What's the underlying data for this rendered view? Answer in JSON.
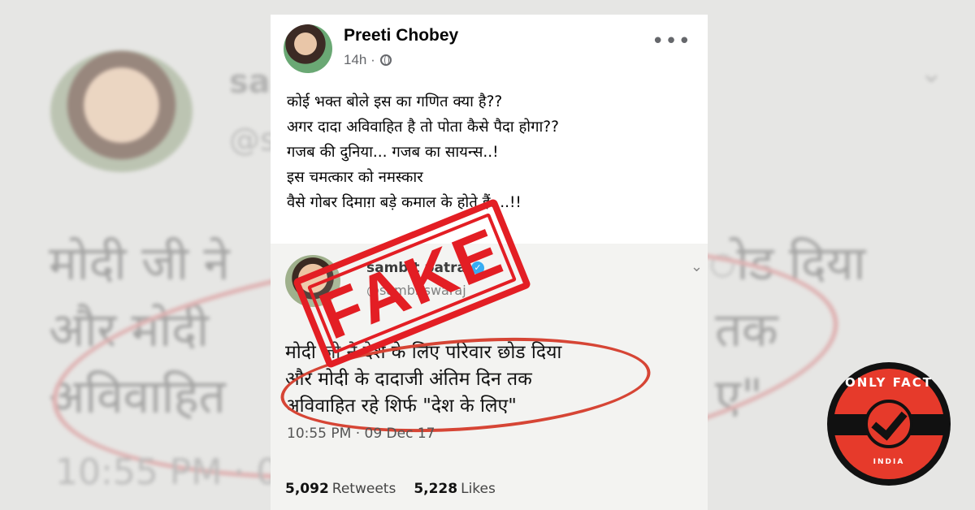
{
  "background": {
    "handle_name": "sa",
    "handle": "@s",
    "lines": [
      "मोदी जी ने",
      "ोड दिया",
      "और मोदी",
      "तक",
      "अविवाहित",
      "ए\""
    ],
    "time": "10:55 PM · 0",
    "caret_icon": "chevron-down-icon"
  },
  "post": {
    "author": "Preeti Chobey",
    "time": "14h ·",
    "privacy_icon": "globe-icon",
    "more_icon": "more-options-icon",
    "more_label": "•••",
    "lines": [
      "कोई भक्त बोले इस का गणित क्या है??",
      "अगर दादा अविवाहित है तो पोता कैसे पैदा होगा??",
      "गजब की दुनिया... गजब का सायन्स..!",
      "इस चमत्कार को नमस्कार",
      "वैसे गोबर दिमाग़ बड़े कमाल के होते हैं....!!"
    ]
  },
  "tweet": {
    "name": "sambit patra",
    "handle": "@sambitswaraj",
    "verified_mark": "✓",
    "caret": "⌄",
    "body": [
      "मोदी जी ने देश के लिए परिवार छोड दिया",
      "और मोदी के दादाजी अंतिम दिन तक",
      "अविवाहित रहे शिर्फ \"देश के लिए\""
    ],
    "time": "10:55 PM · 09 Dec 17",
    "retweets_count": "5,092",
    "retweets_label": "Retweets",
    "likes_count": "5,228",
    "likes_label": "Likes"
  },
  "stamp": {
    "text": "FAKE",
    "color": "#e31e24"
  },
  "logo": {
    "top_text": "ONLY FACT",
    "bottom_text": "INDIA",
    "accent": "#e63a2b"
  }
}
